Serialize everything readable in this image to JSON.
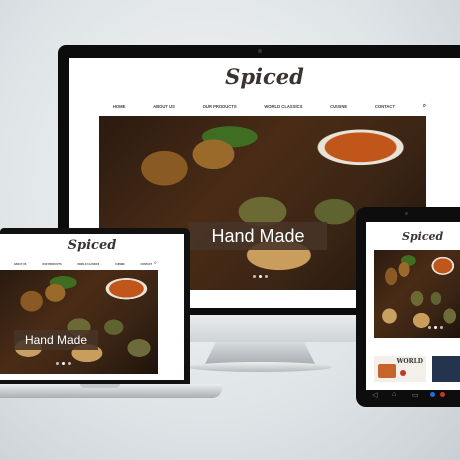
{
  "brand": {
    "logo": "Spiced"
  },
  "nav": {
    "items": [
      "HOME",
      "ABOUT US",
      "OUR PRODUCTS",
      "WORLD CLASSICS",
      "CUISINE",
      "CONTACT"
    ]
  },
  "laptop_nav": {
    "items": [
      "ABOUT US",
      "OUR PRODUCTS",
      "WORLD CLASSICS",
      "CUISINE",
      "CONTACT"
    ]
  },
  "hero": {
    "caption": "Hand Made",
    "slide_count": 3,
    "active_slide": 1
  },
  "tablet": {
    "promo_label": "WORLD"
  },
  "colors": {
    "caption_bg": "#48342880",
    "logo_accent": "#c0392b",
    "frame": "#0c0c0c"
  },
  "icons": [
    "search-icon",
    "back-icon",
    "home-icon",
    "menu-icon"
  ]
}
